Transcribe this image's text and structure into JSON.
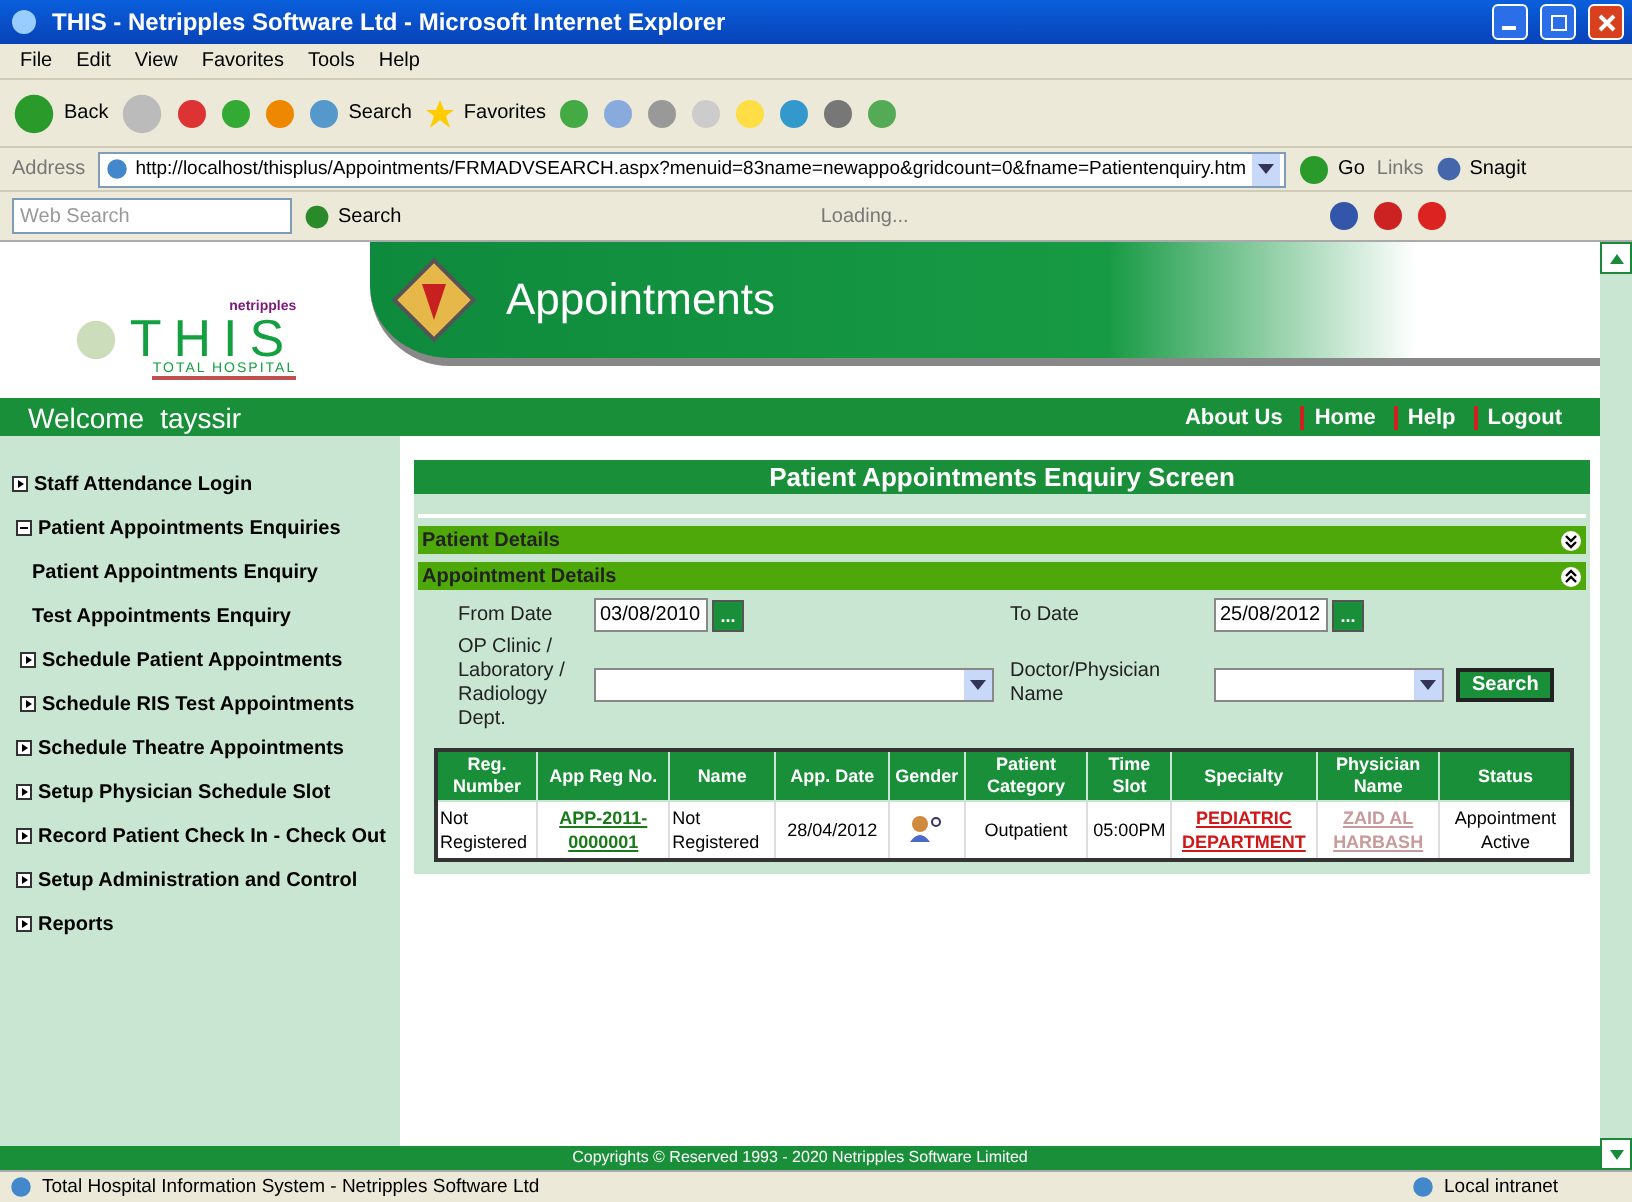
{
  "window": {
    "title": "THIS - Netripples Software Ltd - Microsoft Internet Explorer"
  },
  "menu": [
    "File",
    "Edit",
    "View",
    "Favorites",
    "Tools",
    "Help"
  ],
  "toolbar": {
    "back": "Back",
    "search": "Search",
    "favorites": "Favorites"
  },
  "address_bar": {
    "label": "Address",
    "url": "http://localhost/thisplus/Appointments/FRMADVSEARCH.aspx?menuid=83name=newappo&gridcount=0&fname=Patientenquiry.htm",
    "go": "Go",
    "links": "Links",
    "snagit": "Snagit"
  },
  "search_bar": {
    "placeholder": "Web Search",
    "search": "Search",
    "status": "Loading..."
  },
  "header": {
    "brand_small": "netripples",
    "brand": "THIS",
    "brand_sub": "TOTAL HOSPITAL",
    "title": "Appointments"
  },
  "welcome": {
    "greeting": "Welcome",
    "user": "tayssir",
    "links": [
      "About Us",
      "Home",
      "Help",
      "Logout"
    ]
  },
  "sidebar": {
    "items": [
      {
        "label": "Staff Attendance Login",
        "expanded": false
      },
      {
        "label": "Patient Appointments Enquiries",
        "expanded": true,
        "children": [
          {
            "label": "Patient Appointments Enquiry"
          },
          {
            "label": "Test Appointments Enquiry"
          }
        ]
      },
      {
        "label": "Schedule Patient Appointments",
        "expanded": false
      },
      {
        "label": "Schedule RIS Test Appointments",
        "expanded": false
      },
      {
        "label": "Schedule Theatre Appointments",
        "expanded": false
      },
      {
        "label": "Setup Physician Schedule Slot",
        "expanded": false
      },
      {
        "label": "Record Patient Check In - Check Out",
        "expanded": false
      },
      {
        "label": "Setup Administration and Control",
        "expanded": false
      },
      {
        "label": "Reports",
        "expanded": false
      }
    ]
  },
  "screen_title": "Patient Appointments Enquiry Screen",
  "panels": [
    {
      "title": "Patient Details",
      "expanded": false
    },
    {
      "title": "Appointment Details",
      "expanded": true
    }
  ],
  "form": {
    "from_date": {
      "label": "From Date",
      "value": "03/08/2010"
    },
    "to_date": {
      "label": "To Date",
      "value": "25/08/2012"
    },
    "picker": "...",
    "clinic": {
      "label": "OP Clinic / Laboratory / Radiology Dept."
    },
    "doctor": {
      "label": "Doctor/Physician Name"
    },
    "search": "Search"
  },
  "table": {
    "columns": [
      "Reg. Number",
      "App Reg No.",
      "Name",
      "App. Date",
      "Gender",
      "Patient Category",
      "Time Slot",
      "Specialty",
      "Physician Name",
      "Status"
    ],
    "rows": [
      [
        {
          "kind": "text",
          "text": "Not Registered"
        },
        {
          "kind": "link",
          "text": "APP-2011-0000001",
          "color": "#1a7a1a"
        },
        {
          "kind": "text",
          "text": "Not Registered"
        },
        {
          "kind": "text",
          "text": "28/04/2012"
        },
        {
          "kind": "icon"
        },
        {
          "kind": "text",
          "text": "Outpatient"
        },
        {
          "kind": "text",
          "text": "05:00PM"
        },
        {
          "kind": "link",
          "text": "PEDIATRIC DEPARTMENT",
          "color": "#d01818"
        },
        {
          "kind": "link",
          "text": "ZAID AL HARBASH",
          "color": "#c89a9a"
        },
        {
          "kind": "text",
          "text": "Appointment Active"
        }
      ]
    ]
  },
  "footer": "Copyrights © Reserved 1993 - 2020 Netripples Software Limited",
  "status_bar": {
    "text": "Total Hospital Information System - Netripples Software Ltd",
    "zone": "Local intranet"
  }
}
